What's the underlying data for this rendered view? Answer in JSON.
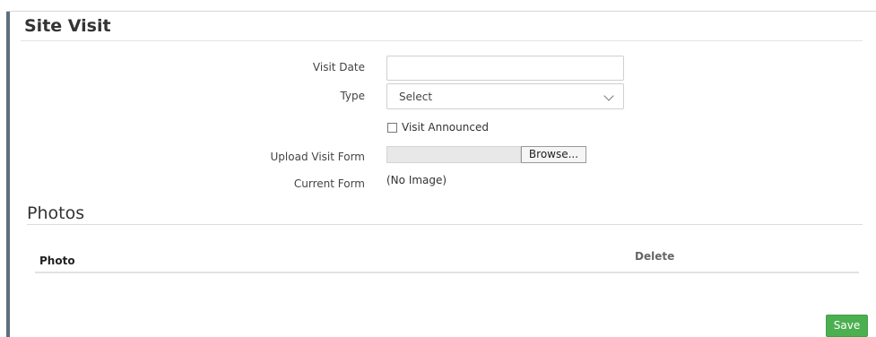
{
  "site_visit": {
    "title": "Site Visit",
    "fields": {
      "visit_date_label": "Visit Date",
      "visit_date_value": "",
      "type_label": "Type",
      "type_selected": "Select",
      "announced_label": "Visit Announced",
      "announced_checked": false,
      "upload_label": "Upload Visit Form",
      "browse_label": "Browse...",
      "current_form_label": "Current Form",
      "current_form_value": "(No Image)"
    }
  },
  "photos": {
    "title": "Photos",
    "columns": [
      "Photo",
      "Delete"
    ],
    "rows": []
  },
  "actions": {
    "save_label": "Save"
  },
  "colors": {
    "accent_bar": "#5c6f7d",
    "save_button": "#4caf50"
  },
  "icons": {
    "type_dropdown": "chevron-down-icon"
  }
}
